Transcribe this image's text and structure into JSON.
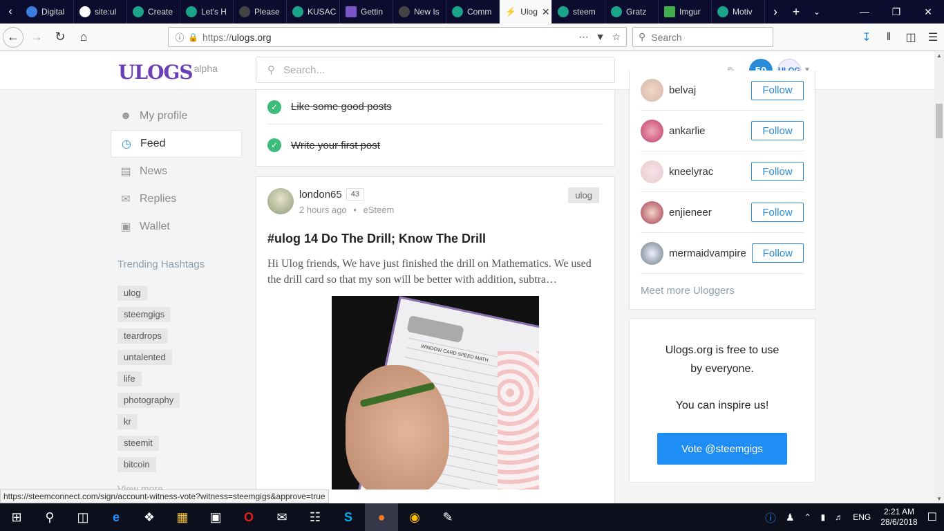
{
  "browser": {
    "tabs": [
      {
        "label": "Digital",
        "color": "#3d7de0"
      },
      {
        "label": "site:ul",
        "color": "#ffffff"
      },
      {
        "label": "Create",
        "color": "#1aa58a"
      },
      {
        "label": "Let's H",
        "color": "#1aa58a"
      },
      {
        "label": "Please",
        "color": "#444444"
      },
      {
        "label": "KUSAC",
        "color": "#1aa58a"
      },
      {
        "label": "Gettin",
        "color": "#7c56c7"
      },
      {
        "label": "New Is",
        "color": "#444444"
      },
      {
        "label": "Comm",
        "color": "#1aa58a"
      },
      {
        "label": "Ulog",
        "color": "#333333"
      },
      {
        "label": "steem",
        "color": "#1aa58a"
      },
      {
        "label": "Gratz",
        "color": "#1aa58a"
      },
      {
        "label": "Imgur",
        "color": "#3fae4b"
      },
      {
        "label": "Motiv",
        "color": "#1aa58a"
      }
    ],
    "url_proto": "https://",
    "url_host": "ulogs.org",
    "search_placeholder": "Search",
    "status_url": "https://steemconnect.com/sign/account-witness-vote?witness=steemgigs&approve=true"
  },
  "site": {
    "logo": "ULOGS",
    "logo_badge": "alpha",
    "search_placeholder": "Search...",
    "voting_power": "50",
    "avatar_text": "ULOG"
  },
  "sidebar": {
    "items": [
      {
        "label": "My profile",
        "icon": "user-icon"
      },
      {
        "label": "Feed",
        "icon": "clock-icon"
      },
      {
        "label": "News",
        "icon": "news-icon"
      },
      {
        "label": "Replies",
        "icon": "chat-icon"
      },
      {
        "label": "Wallet",
        "icon": "wallet-icon"
      }
    ],
    "trending_title": "Trending Hashtags",
    "tags": [
      "ulog",
      "steemgigs",
      "teardrops",
      "untalented",
      "life",
      "photography",
      "kr",
      "steemit",
      "bitcoin"
    ],
    "view_more": "View more"
  },
  "checklist": [
    {
      "label": "Like some good posts"
    },
    {
      "label": "Write your first post"
    }
  ],
  "post": {
    "author": "london65",
    "reputation": "43",
    "time": "2 hours ago",
    "app": "eSteem",
    "tag": "ulog",
    "title": "#ulog 14 Do The Drill; Know The Drill",
    "excerpt": "Hi Ulog friends, We have just finished the drill on Mathematics. We used the drill card so that my son will be better with addition, subtra…",
    "image_caption": "WINDOW CARD SPEED MATH"
  },
  "users": [
    {
      "name": "belvaj",
      "color": "#d6b7a5"
    },
    {
      "name": "ankarlie",
      "color": "#c23b6c"
    },
    {
      "name": "kneelyrac",
      "color": "#e8c8cf"
    },
    {
      "name": "enjieneer",
      "color": "#a33a4b"
    },
    {
      "name": "mermaidvampire",
      "color": "#6d7b83"
    }
  ],
  "follow_label": "Follow",
  "meet_more": "Meet more Uloggers",
  "support": {
    "line1": "Ulogs.org is free to use",
    "line2": "by everyone.",
    "line3": "You can inspire us!",
    "vote_label": "Vote @steemgigs"
  },
  "taskbar": {
    "lang": "ENG",
    "time": "2:21 AM",
    "date": "28/6/2018"
  }
}
